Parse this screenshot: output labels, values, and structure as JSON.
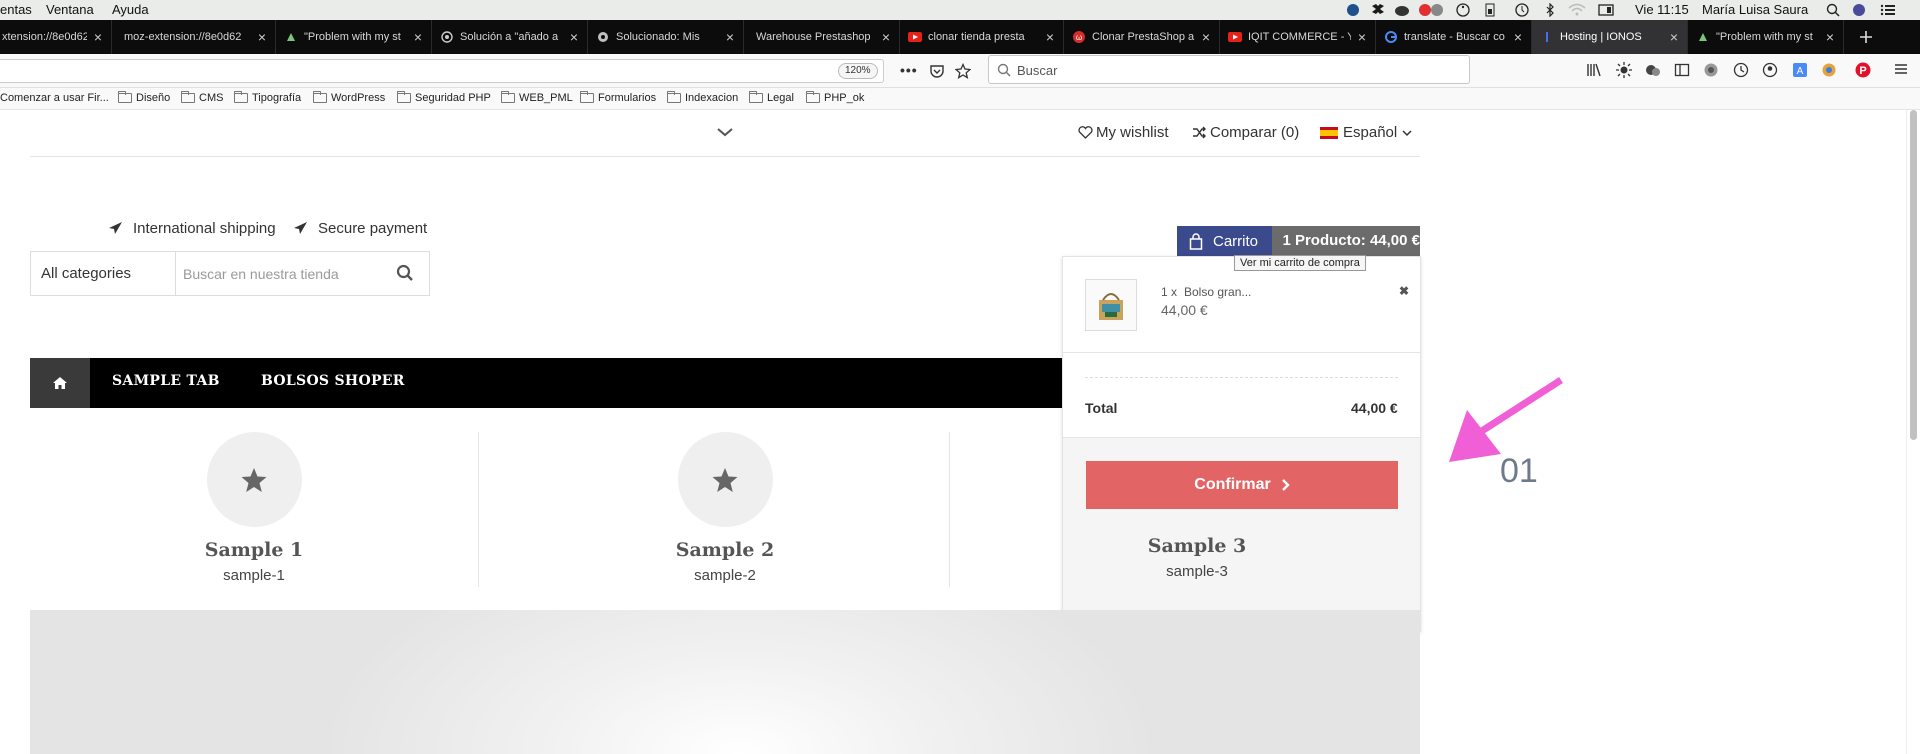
{
  "menubar": {
    "items": [
      "entas",
      "Ventana",
      "Ayuda"
    ],
    "clock": "Vie 11:15",
    "user": "María Luisa Saura"
  },
  "tabs": [
    {
      "label": "xtension://8e0d62",
      "favicon": "none",
      "active": false
    },
    {
      "label": "moz-extension://8e0d62",
      "favicon": "none",
      "active": false
    },
    {
      "label": "\"Problem with my st",
      "favicon": "prestashop-icon",
      "active": false
    },
    {
      "label": "Solución a \"añado a",
      "favicon": "globe-icon",
      "active": false
    },
    {
      "label": "Solucionado: Mis",
      "favicon": "forum-icon",
      "active": false
    },
    {
      "label": "Warehouse Prestashop",
      "favicon": "none",
      "active": false
    },
    {
      "label": "clonar tienda presta",
      "favicon": "youtube-icon",
      "active": false
    },
    {
      "label": "Clonar PrestaShop a",
      "favicon": "red-logo-icon",
      "active": false
    },
    {
      "label": "IQIT COMMERCE - Y",
      "favicon": "youtube-icon",
      "active": false
    },
    {
      "label": "translate - Buscar co",
      "favicon": "google-icon",
      "active": false
    },
    {
      "label": "Hosting | IONOS",
      "favicon": "ionos-icon",
      "active": true
    },
    {
      "label": "\"Problem with my st",
      "favicon": "prestashop-icon",
      "active": false
    }
  ],
  "navbar": {
    "zoom": "120%",
    "search_placeholder": "Buscar"
  },
  "bookmarks": [
    {
      "label": "Comenzar a usar Fir...",
      "folder": false
    },
    {
      "label": "Diseño",
      "folder": true
    },
    {
      "label": "CMS",
      "folder": true
    },
    {
      "label": "Tipografía",
      "folder": true
    },
    {
      "label": "WordPress",
      "folder": true
    },
    {
      "label": "Seguridad PHP",
      "folder": true
    },
    {
      "label": "WEB_PML",
      "folder": true
    },
    {
      "label": "Formularios",
      "folder": true
    },
    {
      "label": "Indexacion",
      "folder": true
    },
    {
      "label": "Legal",
      "folder": true
    },
    {
      "label": "PHP_ok",
      "folder": true
    }
  ],
  "header": {
    "wishlist": "My wishlist",
    "compare": "Comparar (0)",
    "language": "Español"
  },
  "features": {
    "shipping": "International shipping",
    "payment": "Secure payment"
  },
  "search": {
    "category": "All categories",
    "placeholder": "Buscar en nuestra tienda"
  },
  "cart": {
    "label": "Carrito",
    "summary": "1 Producto: 44,00 €",
    "tooltip": "Ver mi carrito de compra",
    "item": {
      "qty": "1 x",
      "name": "Bolso gran...",
      "price": "44,00 €"
    },
    "total_label": "Total",
    "total_value": "44,00 €",
    "confirm": "Confirmar"
  },
  "menu": {
    "items": [
      "SAMPLE TAB",
      "BOLSOS SHOPER"
    ]
  },
  "samples": [
    {
      "title": "Sample 1",
      "subtitle": "sample-1"
    },
    {
      "title": "Sample 2",
      "subtitle": "sample-2"
    },
    {
      "title": "Sample 3",
      "subtitle": "sample-3"
    }
  ],
  "slider": {
    "number": "01"
  },
  "colors": {
    "cart_label_bg": "#3b4a8d",
    "cart_summary_bg": "#6b6b6b",
    "confirm_bg": "#e36464",
    "menu_bg": "#000000",
    "annotation_arrow": "#f05fd6"
  }
}
